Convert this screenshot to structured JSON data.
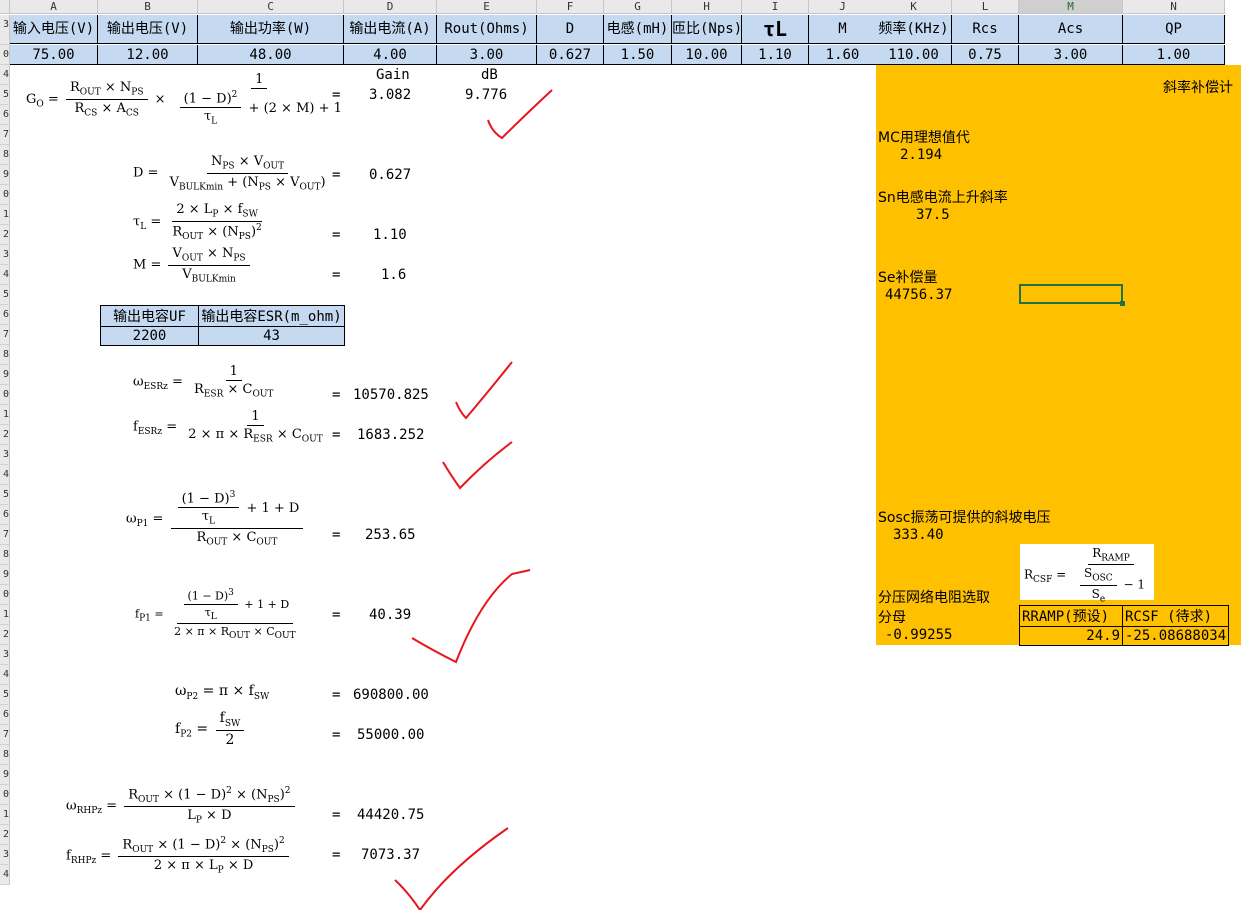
{
  "columns": [
    "A",
    "B",
    "C",
    "D",
    "E",
    "F",
    "G",
    "H",
    "I",
    "J",
    "K",
    "L",
    "M",
    "N"
  ],
  "selected_column": "M",
  "row_numbers": [
    "3",
    "0",
    "4",
    "5",
    "6",
    "7",
    "8",
    "9",
    "0",
    "1",
    "2",
    "3",
    "4",
    "5",
    "6",
    "7",
    "8",
    "9",
    "0",
    "1",
    "2",
    "3",
    "4",
    "5",
    "6",
    "7",
    "8",
    "9",
    "0",
    "1",
    "2",
    "3",
    "4",
    "5",
    "6",
    "7",
    "8",
    "9",
    "0",
    "1",
    "2",
    "3",
    "4"
  ],
  "header_row": [
    "输入电压(V)",
    "输出电压(V)",
    "输出功率(W)",
    "输出电流(A)",
    "Rout(Ohms)",
    "D",
    "电感(mH)",
    "匝比(Nps)",
    "τL",
    "M",
    "频率(KHz)",
    "Rcs",
    "Acs",
    "QP"
  ],
  "value_row": [
    "75.00",
    "12.00",
    "48.00",
    "4.00",
    "3.00",
    "0.627",
    "1.50",
    "10.00",
    "1.10",
    "1.60",
    "110.00",
    "0.75",
    "3.00",
    "1.00"
  ],
  "gain_header": "Gain",
  "db_header": "dB",
  "results": {
    "go_gain": "3.082",
    "go_db": "9.776",
    "d": "0.627",
    "tau_l": "1.10",
    "m": "1.6",
    "w_esrz": "10570.825",
    "f_esrz": "1683.252",
    "w_p1": "253.65",
    "f_p1": "40.39",
    "w_p2": "690800.00",
    "f_p2": "55000.00",
    "w_rhpz": "44420.75",
    "f_rhpz": "7073.37"
  },
  "equals_sign": "=",
  "cap_table": {
    "headers": [
      "输出电容UF",
      "输出电容ESR(m_ohm)"
    ],
    "values": [
      "2200",
      "43"
    ]
  },
  "slope_panel": {
    "title": "斜率补偿计",
    "mc_label": "MC用理想值代",
    "mc_value": "2.194",
    "sn_label": "Sn电感电流上升斜率",
    "sn_value": "37.5",
    "se_label": "Se补偿量",
    "se_value": "44756.37",
    "sosc_label": "Sosc振荡可提供的斜坡电压",
    "sosc_value": "333.40",
    "divider_label_1": "分压网络电阻选取",
    "divider_label_2": "分母",
    "divider_value": "-0.99255",
    "rramp_header": "RRAMP(预设)",
    "rcsf_header": "RCSF (待求)",
    "rramp_value": "24.9",
    "rcsf_value": "-25.08688034"
  },
  "colors": {
    "header_blue": "#c5d9f1",
    "panel_orange": "#ffc000",
    "check_red": "#e8161b",
    "selection_green": "#217346"
  }
}
